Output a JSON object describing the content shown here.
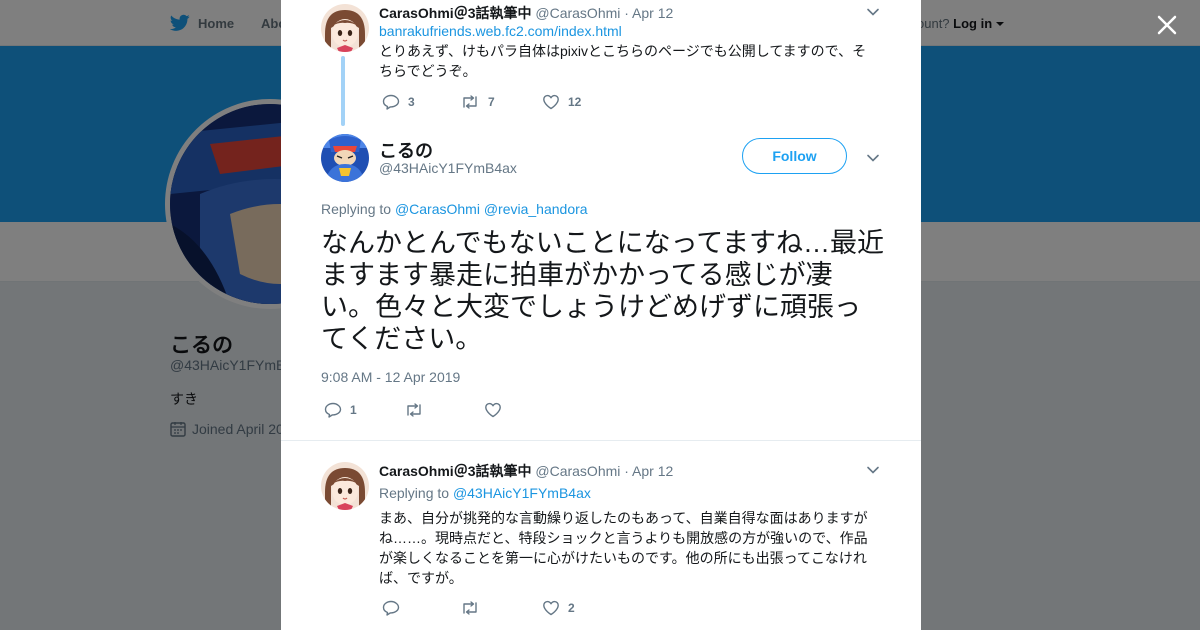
{
  "background": {
    "nav": {
      "home": "Home",
      "about": "Abo",
      "account_question": "ccount?",
      "login": "Log in"
    },
    "profile": {
      "name": "こるの",
      "handle": "@43HAicY1FYmB",
      "bio": "すき",
      "joined": "Joined April 20"
    }
  },
  "modal": {
    "parent_tweet": {
      "name": "CarasOhmi＠3話執筆中",
      "handle": "@CarasOhmi",
      "date": "· Apr 12",
      "link": "banrakufriends.web.fc2.com/index.html",
      "text": "とりあえず、けもパラ自体はpixivとこちらのページでも公開してますので、そちらでどうぞ。",
      "replies": "3",
      "retweets": "7",
      "likes": "12"
    },
    "main_tweet": {
      "name": "こるの",
      "handle": "@43HAicY1FYmB4ax",
      "follow_label": "Follow",
      "replying_prefix": "Replying to",
      "replying_to_1": "@CarasOhmi",
      "replying_to_2": "@revia_handora",
      "text": "なんかとんでもないことになってますね…最近ますます暴走に拍車がかかってる感じが凄い。色々と大変でしょうけどめげずに頑張ってください。",
      "timestamp": "9:08 AM - 12 Apr 2019",
      "replies": "1",
      "retweets": "",
      "likes": ""
    },
    "reply_tweet": {
      "name": "CarasOhmi＠3話執筆中",
      "handle": "@CarasOhmi",
      "date": "· Apr 12",
      "replying_prefix": "Replying to",
      "replying_to": "@43HAicY1FYmB4ax",
      "text": "まあ、自分が挑発的な言動繰り返したのもあって、自業自得な面はありますがね……。現時点だと、特段ショックと言うよりも開放感の方が強いので、作品が楽しくなることを第一に心がけたいものです。他の所にも出張ってこなければ、ですが。",
      "replies": "",
      "retweets": "",
      "likes": "2"
    }
  },
  "colors": {
    "accent": "#1da1f2",
    "link": "#1b95e0",
    "secondary_text": "#657786",
    "thread_line": "#a2d2f7"
  },
  "icons": [
    "twitter-bird-icon",
    "close-icon",
    "caret-down-icon",
    "reply-icon",
    "retweet-icon",
    "like-icon",
    "calendar-icon"
  ]
}
